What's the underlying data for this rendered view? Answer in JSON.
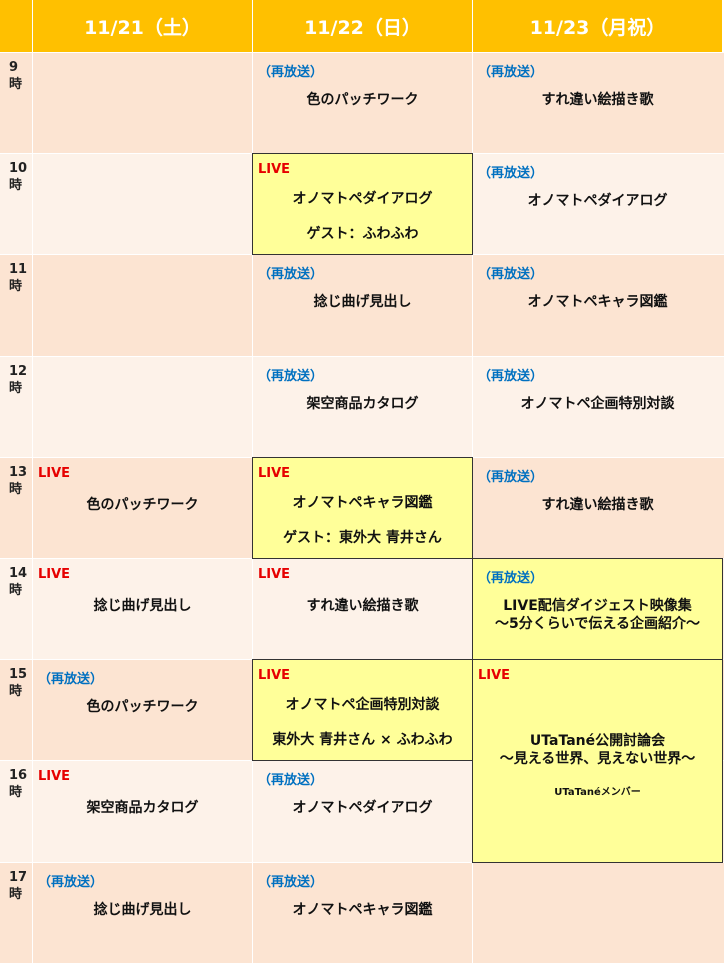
{
  "header": {
    "days": [
      "11/21（土）",
      "11/22（日）",
      "11/23（月祝）"
    ]
  },
  "hours": [
    {
      "num": "9",
      "suffix": "時"
    },
    {
      "num": "10",
      "suffix": "時"
    },
    {
      "num": "11",
      "suffix": "時"
    },
    {
      "num": "12",
      "suffix": "時"
    },
    {
      "num": "13",
      "suffix": "時"
    },
    {
      "num": "14",
      "suffix": "時"
    },
    {
      "num": "15",
      "suffix": "時"
    },
    {
      "num": "16",
      "suffix": "時"
    },
    {
      "num": "17",
      "suffix": "時"
    }
  ],
  "tags": {
    "live": "LIVE",
    "rerun": "（再放送）"
  },
  "events": [
    {
      "day": 1,
      "start": 0,
      "span": 1,
      "type": "rerun",
      "lines": [
        "色のパッチワーク"
      ]
    },
    {
      "day": 2,
      "start": 0,
      "span": 1,
      "type": "rerun",
      "lines": [
        "すれ違い絵描き歌"
      ]
    },
    {
      "day": 1,
      "start": 1,
      "span": 1,
      "type": "live",
      "lines": [
        "オノマトペダイアログ",
        "ゲスト：ふわふわ"
      ]
    },
    {
      "day": 2,
      "start": 1,
      "span": 1,
      "type": "rerun",
      "lines": [
        "オノマトペダイアログ"
      ]
    },
    {
      "day": 1,
      "start": 2,
      "span": 1,
      "type": "rerun",
      "lines": [
        "捻じ曲げ見出し"
      ]
    },
    {
      "day": 2,
      "start": 2,
      "span": 1,
      "type": "rerun",
      "lines": [
        "オノマトペキャラ図鑑"
      ]
    },
    {
      "day": 1,
      "start": 3,
      "span": 1,
      "type": "rerun",
      "lines": [
        "架空商品カタログ"
      ]
    },
    {
      "day": 2,
      "start": 3,
      "span": 1,
      "type": "rerun",
      "lines": [
        "オノマトペ企画特別対談"
      ]
    },
    {
      "day": 0,
      "start": 4,
      "span": 1,
      "type": "live-plain",
      "lines": [
        "色のパッチワーク"
      ]
    },
    {
      "day": 1,
      "start": 4,
      "span": 1,
      "type": "live",
      "lines": [
        "オノマトペキャラ図鑑",
        "ゲスト：東外大 青井さん"
      ]
    },
    {
      "day": 2,
      "start": 4,
      "span": 1,
      "type": "rerun",
      "lines": [
        "すれ違い絵描き歌"
      ]
    },
    {
      "day": 0,
      "start": 5,
      "span": 1,
      "type": "live-plain",
      "lines": [
        "捻じ曲げ見出し"
      ]
    },
    {
      "day": 1,
      "start": 5,
      "span": 1,
      "type": "live-plain",
      "lines": [
        "すれ違い絵描き歌"
      ]
    },
    {
      "day": 2,
      "start": 5,
      "span": 1,
      "type": "rerun-box",
      "lines": [
        "LIVE配信ダイジェスト映像集",
        "～5分くらいで伝える企画紹介～"
      ]
    },
    {
      "day": 0,
      "start": 6,
      "span": 1,
      "type": "rerun",
      "lines": [
        "色のパッチワーク"
      ]
    },
    {
      "day": 1,
      "start": 6,
      "span": 1,
      "type": "live",
      "lines": [
        "オノマトペ企画特別対談",
        "東外大 青井さん × ふわふわ"
      ]
    },
    {
      "day": 2,
      "start": 6,
      "span": 2,
      "type": "live-big",
      "lines": [
        "UTaTané公開討論会",
        "～見える世界、見えない世界～",
        "UTaTanéメンバー"
      ]
    },
    {
      "day": 0,
      "start": 7,
      "span": 1,
      "type": "live-plain",
      "lines": [
        "架空商品カタログ"
      ]
    },
    {
      "day": 1,
      "start": 7,
      "span": 1,
      "type": "rerun",
      "lines": [
        "オノマトペダイアログ"
      ]
    },
    {
      "day": 0,
      "start": 8,
      "span": 1,
      "type": "rerun",
      "lines": [
        "捻じ曲げ見出し"
      ]
    },
    {
      "day": 1,
      "start": 8,
      "span": 1,
      "type": "rerun",
      "lines": [
        "オノマトペキャラ図鑑"
      ]
    }
  ],
  "colors": {
    "header": "#FFC000",
    "row_dark": "#FCE4D2",
    "row_light": "#FDF2E9",
    "live_box": "#FFFF99",
    "live_text": "#E60000",
    "rerun_text": "#0070C0"
  }
}
